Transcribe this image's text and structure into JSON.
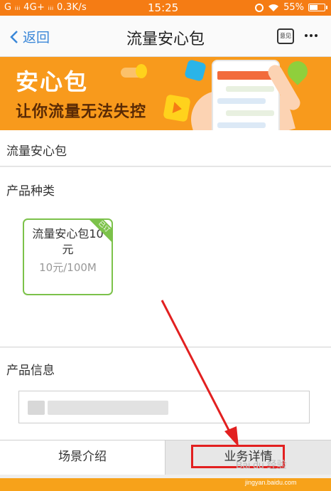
{
  "status_bar": {
    "left": "G ᵢᵢᵢ 4G+ ᵢᵢᵢ 0.3K/s",
    "time": "15:25",
    "battery": "55%"
  },
  "nav": {
    "back_label": "返回",
    "title": "流量安心包",
    "feedback_icon_label": "意见"
  },
  "banner": {
    "headline": "安心包",
    "slogan": "让你流量无法失控"
  },
  "section_title": "流量安心包",
  "category": {
    "label": "产品种类",
    "product": {
      "name": "流量安心包10元",
      "price": "10元/100M",
      "corner_tag": "已订"
    }
  },
  "info": {
    "label": "产品信息"
  },
  "tabs": [
    {
      "label": "场景介绍"
    },
    {
      "label": "业务详情"
    }
  ],
  "watermark": {
    "text": "Bai du 经验",
    "url": "jingyan.baidu.com"
  },
  "colors": {
    "brand_orange": "#f57c14",
    "banner_orange": "#f89a1c",
    "link_blue": "#3a87d8",
    "product_green": "#7cc24a",
    "annotation_red": "#e22020"
  }
}
